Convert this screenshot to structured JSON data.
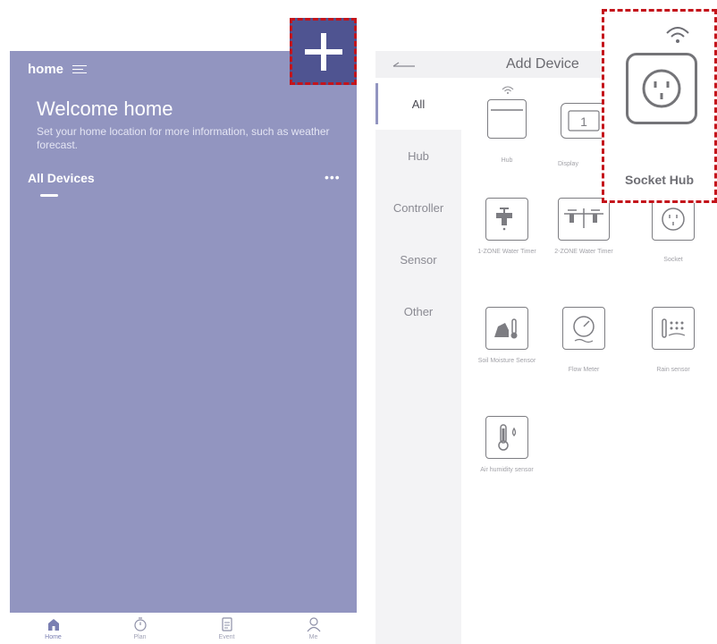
{
  "left_screen": {
    "home_title": "home",
    "welcome_title": "Welcome home",
    "welcome_subtitle": "Set your home location for more information, such as weather forecast.",
    "all_devices": "All Devices",
    "more": "•••",
    "tabs": [
      {
        "label": "Home",
        "icon": "home-icon"
      },
      {
        "label": "Plan",
        "icon": "timer-icon"
      },
      {
        "label": "Event",
        "icon": "document-icon"
      },
      {
        "label": "Me",
        "icon": "user-icon"
      }
    ]
  },
  "right_screen": {
    "title": "Add Device",
    "categories": [
      "All",
      "Hub",
      "Controller",
      "Sensor",
      "Other"
    ],
    "devices": [
      {
        "label": "Hub",
        "icon": "hub-icon"
      },
      {
        "label": "Display",
        "icon": "display-icon"
      },
      {
        "label": "1-ZONE Water Timer",
        "icon": "water-timer-icon"
      },
      {
        "label": "2-ZONE Water Timer",
        "icon": "two-zone-timer-icon"
      },
      {
        "label": "Socket",
        "icon": "socket-icon"
      },
      {
        "label": "Soil Moisture Sensor",
        "icon": "soil-moisture-icon"
      },
      {
        "label": "Flow Meter",
        "icon": "flow-meter-icon"
      },
      {
        "label": "Rain sensor",
        "icon": "rain-sensor-icon"
      },
      {
        "label": "Air humidity sensor",
        "icon": "air-humidity-icon"
      }
    ]
  },
  "callout": {
    "label": "Socket Hub",
    "highlight_color": "#c4141b"
  },
  "colors": {
    "header_purple": "#9295c0",
    "plus_button": "#4f5491"
  }
}
